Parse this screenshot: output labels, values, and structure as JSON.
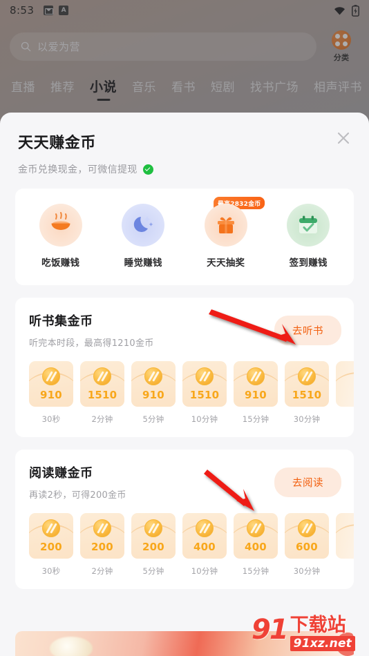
{
  "statusbar": {
    "time": "8:53",
    "icons": [
      "mail-icon",
      "a-badge-icon",
      "wifi-icon",
      "battery-charging-icon"
    ]
  },
  "search": {
    "placeholder": "以爱为营",
    "value": "以爱为营",
    "icon": "search-icon"
  },
  "category_button": {
    "label": "分类",
    "icon": "grid-dots-icon"
  },
  "tabs": [
    {
      "label": "直播",
      "active": false
    },
    {
      "label": "推荐",
      "active": false
    },
    {
      "label": "小说",
      "active": true
    },
    {
      "label": "音乐",
      "active": false
    },
    {
      "label": "看书",
      "active": false
    },
    {
      "label": "短剧",
      "active": false
    },
    {
      "label": "找书广场",
      "active": false
    },
    {
      "label": "相声评书",
      "active": false
    }
  ],
  "sheet": {
    "title": "天天赚金币",
    "subtitle": "金币兑换现金，可微信提现",
    "subtitle_badge": "wechat-verified-icon",
    "close_icon": "close-icon"
  },
  "tasks": [
    {
      "label": "吃饭赚钱",
      "icon": "bowl-food-icon",
      "badge": null
    },
    {
      "label": "睡觉赚钱",
      "icon": "moon-sleep-icon",
      "badge": null
    },
    {
      "label": "天天抽奖",
      "icon": "gift-box-icon",
      "badge": "最高2832金币"
    },
    {
      "label": "签到赚钱",
      "icon": "calendar-check-icon",
      "badge": null
    }
  ],
  "listen_section": {
    "title": "听书集金币",
    "subtitle": "听完本时段，最高得1210金币",
    "action_label": "去听书",
    "items": [
      {
        "value": "910",
        "caption": "30秒"
      },
      {
        "value": "1510",
        "caption": "2分钟"
      },
      {
        "value": "910",
        "caption": "5分钟"
      },
      {
        "value": "1510",
        "caption": "10分钟"
      },
      {
        "value": "910",
        "caption": "15分钟"
      },
      {
        "value": "1510",
        "caption": "30分钟"
      }
    ]
  },
  "read_section": {
    "title": "阅读赚金币",
    "subtitle": "再读2秒，可得200金币",
    "action_label": "去阅读",
    "items": [
      {
        "value": "200",
        "caption": "30秒"
      },
      {
        "value": "200",
        "caption": "2分钟"
      },
      {
        "value": "200",
        "caption": "5分钟"
      },
      {
        "value": "400",
        "caption": "10分钟"
      },
      {
        "value": "400",
        "caption": "15分钟"
      },
      {
        "value": "600",
        "caption": "30分钟"
      }
    ]
  },
  "annotations": [
    {
      "name": "arrow-to-listen-button",
      "color": "#ee1c13"
    },
    {
      "name": "arrow-to-read-button",
      "color": "#ee1c13"
    }
  ],
  "watermark": {
    "logo": "91",
    "cn": "下载站",
    "domain": "91xz.net",
    "color": "#ef4136"
  },
  "colors": {
    "accent_orange": "#f2600f",
    "coin_gold": "#f8a71b",
    "button_bg": "#fdeade",
    "sheet_bg": "#f6f6f8",
    "wechat_green": "#1fbf40"
  }
}
